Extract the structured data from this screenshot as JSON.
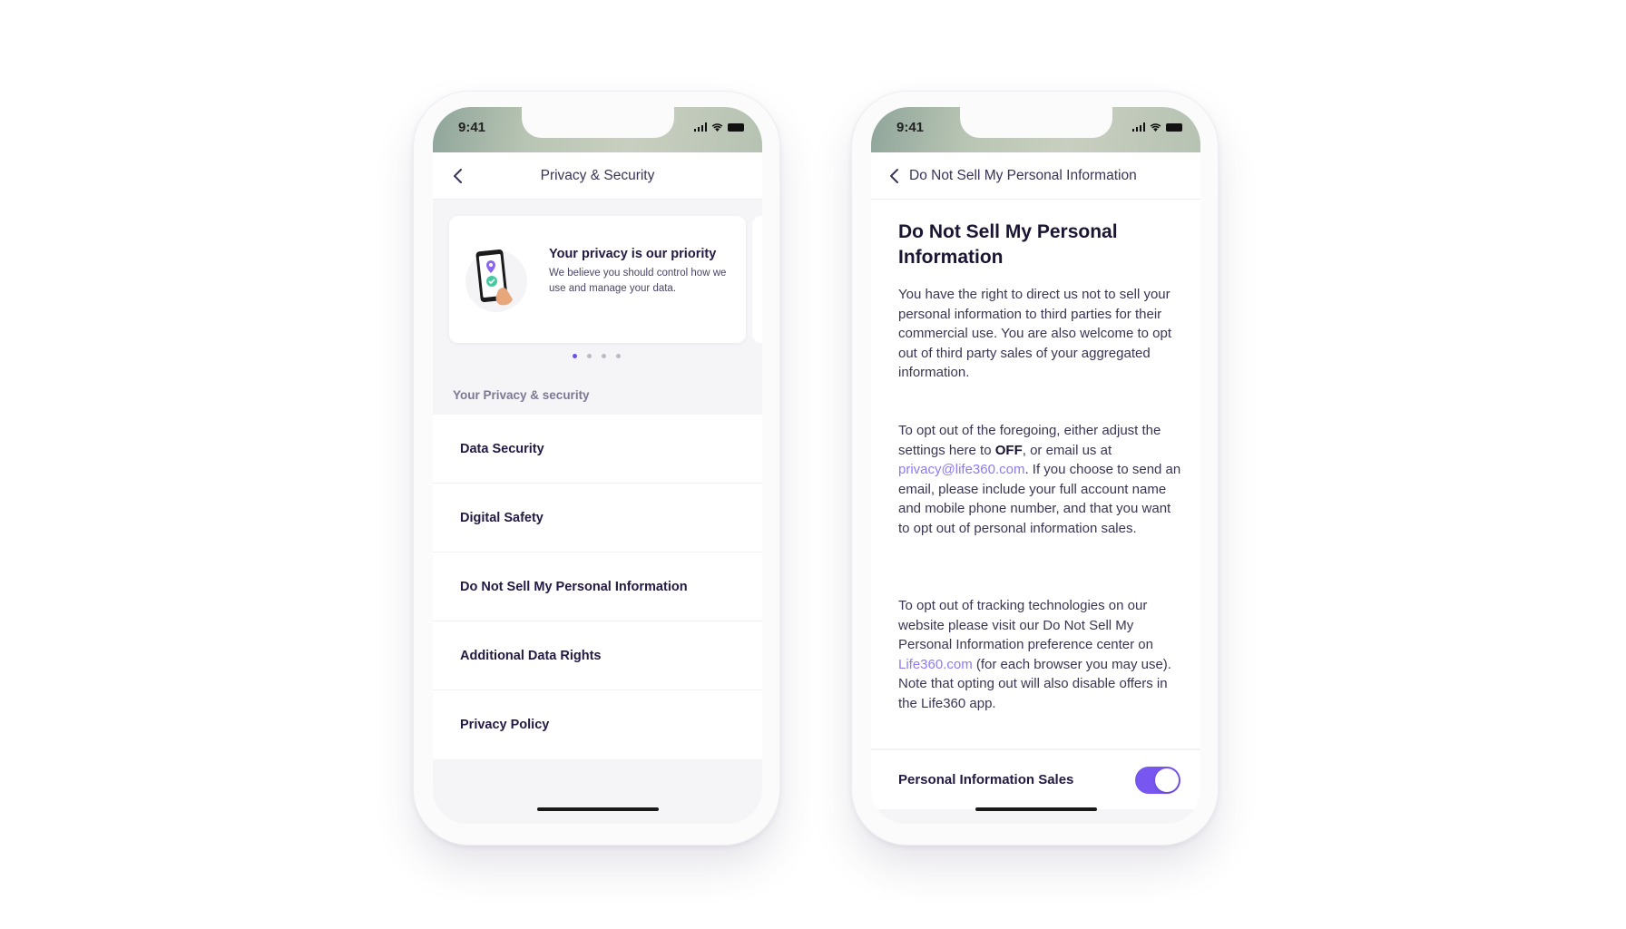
{
  "colors": {
    "accent": "#7856f0",
    "link": "#8f7af5",
    "text_primary": "#231942",
    "text_secondary": "#7d7894"
  },
  "left_phone": {
    "status_bar": {
      "time": "9:41",
      "icons": [
        "cellular-signal-icon",
        "wifi-icon",
        "battery-icon"
      ]
    },
    "navbar": {
      "back_icon": "chevron-left-icon",
      "title": "Privacy & Security"
    },
    "carousel": {
      "card": {
        "illustration": "phone-location-check-illustration",
        "title": "Your privacy is our priority",
        "body": "We believe you should control how we use and manage your data."
      },
      "page_count": 4,
      "active_page": 1
    },
    "section_label": "Your Privacy & security",
    "menu_items": [
      {
        "label": "Data Security"
      },
      {
        "label": "Digital Safety"
      },
      {
        "label": "Do Not Sell My Personal Information"
      },
      {
        "label": "Additional Data Rights"
      },
      {
        "label": "Privacy Policy"
      }
    ]
  },
  "right_phone": {
    "status_bar": {
      "time": "9:41",
      "icons": [
        "cellular-signal-icon",
        "wifi-icon",
        "battery-icon"
      ]
    },
    "navbar": {
      "back_icon": "chevron-left-icon",
      "title": "Do Not Sell My Personal Information"
    },
    "heading": "Do Not Sell My Personal Information",
    "paragraph_1": "You have the right to direct us not to sell your personal information to third parties for their commercial use. You are also welcome to opt out of third party sales of your aggregated information.",
    "paragraph_2": {
      "part_1": "To opt out of the foregoing, either adjust the settings here to ",
      "bold": "OFF",
      "part_2": ", or email us at ",
      "email_link": "privacy@life360.com",
      "part_3": ". If you choose to send an email, please include your full account name and mobile phone number, and that you want to opt out of personal information sales."
    },
    "paragraph_3": {
      "part_1": "To opt out of tracking technologies on our website please visit our Do Not Sell My Personal Information preference center on ",
      "site_link": "Life360.com",
      "part_2": " (for each browser you may use).  Note that opting out will also disable offers in the Life360 app."
    },
    "toggle": {
      "label": "Personal Information Sales",
      "state": "on"
    }
  }
}
